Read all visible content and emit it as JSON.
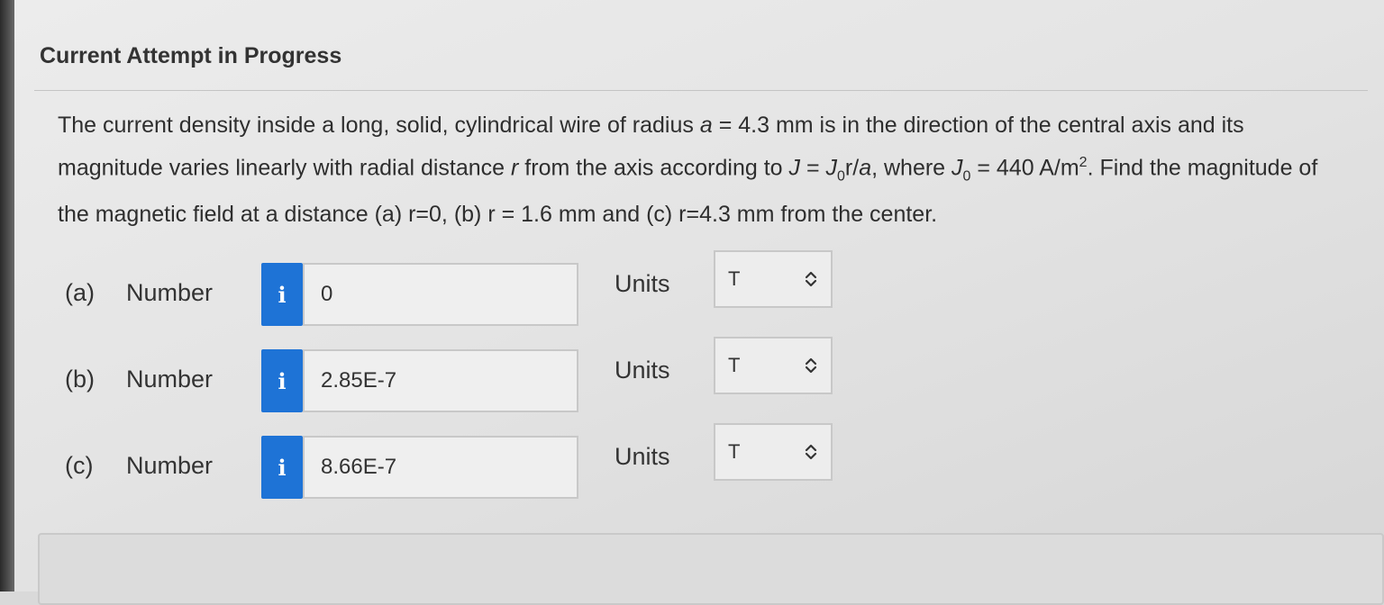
{
  "header": {
    "attempt_title": "Current Attempt in Progress"
  },
  "question": {
    "text_1": "The current density inside a long, solid, cylindrical wire of radius ",
    "var_a": "a",
    "text_2": " = 4.3 mm is in the direction of the central axis and its magnitude varies linearly with radial distance ",
    "var_r": "r",
    "text_3": " from the axis according to ",
    "var_J": "J",
    "text_4": " = ",
    "var_J0": "J",
    "sub_0": "0",
    "text_5": "r/",
    "var_a2": "a",
    "text_6": ", where ",
    "var_J0b": "J",
    "sub_0b": "0",
    "text_7": " = 440 A/m",
    "sup_2": "2",
    "text_8": ". Find the magnitude of the magnetic field at a distance (a) r=0, (b) r = 1.6 mm and (c) r=4.3 mm from the center."
  },
  "answers": [
    {
      "part": "(a)",
      "number_label": "Number",
      "info": "i",
      "value": "0",
      "units_label": "Units",
      "unit": "T"
    },
    {
      "part": "(b)",
      "number_label": "Number",
      "info": "i",
      "value": "2.85E-7",
      "units_label": "Units",
      "unit": "T"
    },
    {
      "part": "(c)",
      "number_label": "Number",
      "info": "i",
      "value": "8.66E-7",
      "units_label": "Units",
      "unit": "T"
    }
  ],
  "icons": {
    "info": "info-icon",
    "select_arrow": "chevron-updown-icon"
  },
  "colors": {
    "info_button": "#1e73d6",
    "background": "#e6e6e6"
  }
}
